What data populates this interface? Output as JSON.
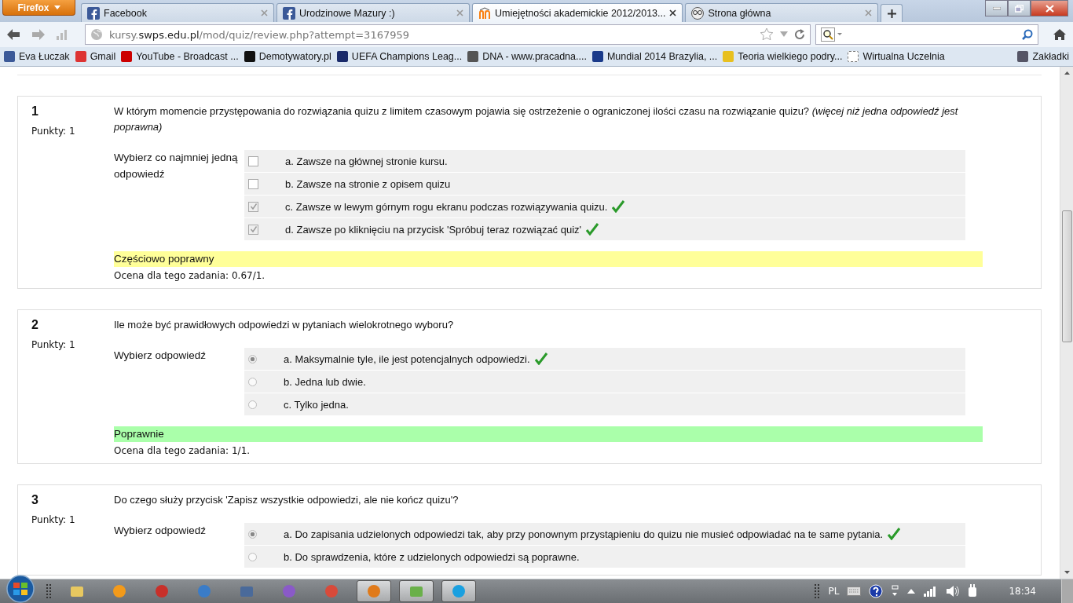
{
  "browser": {
    "menu_button": "Firefox",
    "tabs": [
      {
        "title": "Facebook",
        "selected": false
      },
      {
        "title": "Urodzinowe Mazury :)",
        "selected": false
      },
      {
        "title": "Umiejętności akademickie 2012/2013...",
        "selected": true
      },
      {
        "title": "Strona główna",
        "selected": false
      }
    ],
    "address": {
      "prefix": "kursy.",
      "domain": "swps.edu.pl",
      "path": "/mod/quiz/review.php?attempt=3167959"
    },
    "bookmarks": [
      "Eva Łuczak",
      "Gmail",
      "YouTube - Broadcast ...",
      "Demotywatory.pl",
      "UEFA Champions Leag...",
      "DNA - www.pracadna....",
      "Mundial 2014 Brazylia, ...",
      "Teoria wielkiego podry...",
      "Wirtualna Uczelnia"
    ],
    "bookmarks_menu": "Zakładki"
  },
  "questions": [
    {
      "number": "1",
      "points": "Punkty: 1",
      "text": "W którym momencie przystępowania do rozwiązania quizu z limitem czasowym pojawia się ostrzeżenie o ograniczonej ilości czasu na rozwiązanie quizu? *(więcej niż jedna odpowiedź jest poprawna)*",
      "prompt": "Wybierz co najmniej jedną odpowiedź",
      "kind": "checkbox",
      "options": [
        {
          "label": "a. Zawsze na głównej stronie kursu.",
          "checked": false,
          "correct": false
        },
        {
          "label": "b. Zawsze na stronie z opisem quizu",
          "checked": false,
          "correct": false
        },
        {
          "label": "c. Zawsze w lewym górnym rogu ekranu podczas rozwiązywania quizu.",
          "checked": true,
          "correct": true
        },
        {
          "label": "d. Zawsze po kliknięciu na przycisk 'Spróbuj teraz rozwiązać quiz'",
          "checked": true,
          "correct": true
        }
      ],
      "feedback": {
        "text": "Częściowo poprawny",
        "kind": "partial"
      },
      "grade": "Ocena dla tego zadania: 0.67/1."
    },
    {
      "number": "2",
      "points": "Punkty: 1",
      "text": "Ile może być prawidłowych odpowiedzi w pytaniach wielokrotnego wyboru?",
      "prompt": "Wybierz odpowiedź",
      "kind": "radio",
      "options": [
        {
          "label": "a. Maksymalnie tyle, ile jest potencjalnych odpowiedzi.",
          "checked": true,
          "correct": true
        },
        {
          "label": "b. Jedna lub dwie.",
          "checked": false,
          "correct": false
        },
        {
          "label": "c. Tylko jedna.",
          "checked": false,
          "correct": false
        }
      ],
      "feedback": {
        "text": "Poprawnie",
        "kind": "correct"
      },
      "grade": "Ocena dla tego zadania: 1/1."
    },
    {
      "number": "3",
      "points": "Punkty: 1",
      "text": "Do czego służy przycisk 'Zapisz wszystkie odpowiedzi, ale nie kończ quizu'?",
      "prompt": "Wybierz odpowiedź",
      "kind": "radio",
      "options": [
        {
          "label": "a. Do zapisania udzielonych odpowiedzi tak, aby przy ponownym przystąpieniu do quizu nie musieć odpowiadać na te same pytania.",
          "checked": true,
          "correct": true
        },
        {
          "label": "b. Do sprawdzenia, które z udzielonych odpowiedzi są poprawne.",
          "checked": false,
          "correct": false
        }
      ]
    }
  ],
  "taskbar": {
    "apps": [
      {
        "kind": "folder",
        "running": false
      },
      {
        "kind": "sun",
        "running": false
      },
      {
        "kind": "cleaner",
        "running": false
      },
      {
        "kind": "disc",
        "running": false
      },
      {
        "kind": "film",
        "running": false
      },
      {
        "kind": "paw",
        "running": false
      },
      {
        "kind": "chrome",
        "running": false
      },
      {
        "kind": "firefox",
        "running": true
      },
      {
        "kind": "windows",
        "running": true
      },
      {
        "kind": "skype",
        "running": true
      }
    ],
    "language": "PL",
    "time": "18:34"
  }
}
